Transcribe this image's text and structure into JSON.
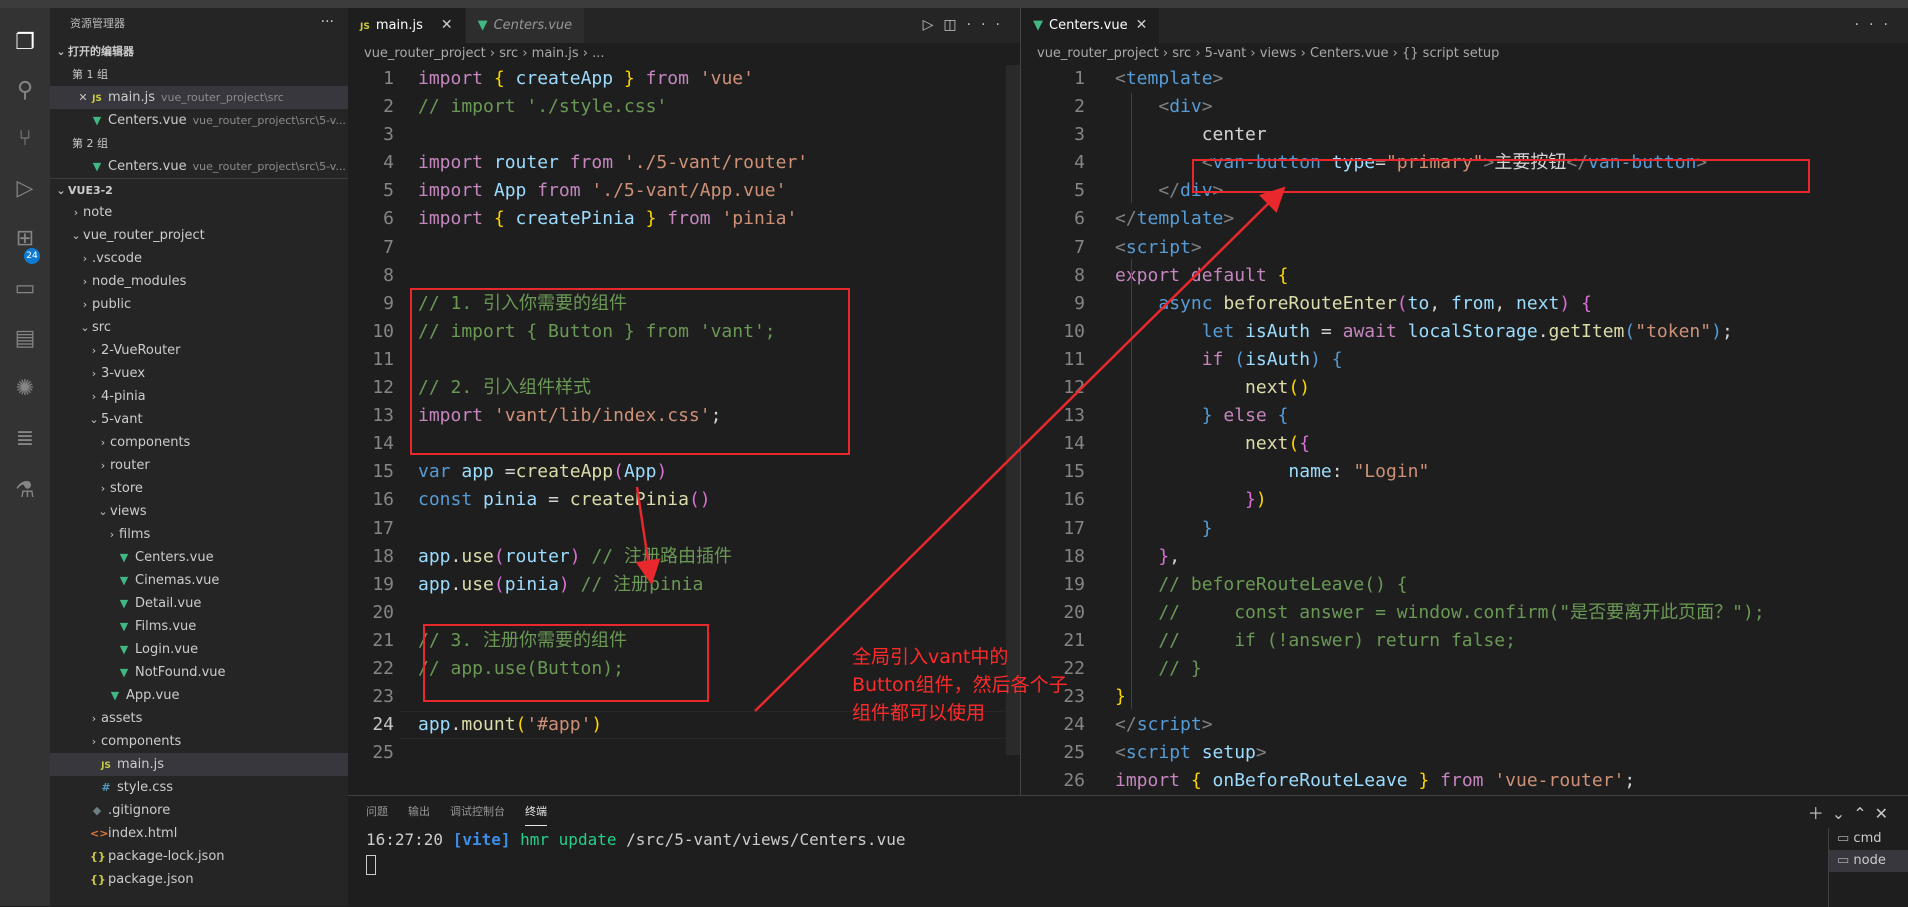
{
  "explorer": {
    "title": "资源管理器",
    "open_editors_header": "打开的编辑器",
    "group1": "第 1 组",
    "group1_file": "main.js",
    "group1_file_path": "vue_router_project\\src",
    "group1_file2": "Centers.vue",
    "group1_file2_path": "vue_router_project\\src\\5-v...",
    "group2": "第 2 组",
    "group2_file": "Centers.vue",
    "group2_file_path": "vue_router_project\\src\\5-v...",
    "workspace": "VUE3-2",
    "tree": [
      {
        "label": "note",
        "depth": 1,
        "kind": "folder",
        "open": false
      },
      {
        "label": "vue_router_project",
        "depth": 1,
        "kind": "folder",
        "open": true
      },
      {
        "label": ".vscode",
        "depth": 2,
        "kind": "folder",
        "open": false
      },
      {
        "label": "node_modules",
        "depth": 2,
        "kind": "folder",
        "open": false
      },
      {
        "label": "public",
        "depth": 2,
        "kind": "folder",
        "open": false
      },
      {
        "label": "src",
        "depth": 2,
        "kind": "folder",
        "open": true
      },
      {
        "label": "2-VueRouter",
        "depth": 3,
        "kind": "folder",
        "open": false
      },
      {
        "label": "3-vuex",
        "depth": 3,
        "kind": "folder",
        "open": false
      },
      {
        "label": "4-pinia",
        "depth": 3,
        "kind": "folder",
        "open": false
      },
      {
        "label": "5-vant",
        "depth": 3,
        "kind": "folder",
        "open": true
      },
      {
        "label": "components",
        "depth": 4,
        "kind": "folder",
        "open": false
      },
      {
        "label": "router",
        "depth": 4,
        "kind": "folder",
        "open": false
      },
      {
        "label": "store",
        "depth": 4,
        "kind": "folder",
        "open": false
      },
      {
        "label": "views",
        "depth": 4,
        "kind": "folder",
        "open": true
      },
      {
        "label": "films",
        "depth": 5,
        "kind": "folder",
        "open": false
      },
      {
        "label": "Centers.vue",
        "depth": 5,
        "kind": "vue"
      },
      {
        "label": "Cinemas.vue",
        "depth": 5,
        "kind": "vue"
      },
      {
        "label": "Detail.vue",
        "depth": 5,
        "kind": "vue"
      },
      {
        "label": "Films.vue",
        "depth": 5,
        "kind": "vue"
      },
      {
        "label": "Login.vue",
        "depth": 5,
        "kind": "vue"
      },
      {
        "label": "NotFound.vue",
        "depth": 5,
        "kind": "vue"
      },
      {
        "label": "App.vue",
        "depth": 4,
        "kind": "vue"
      },
      {
        "label": "assets",
        "depth": 3,
        "kind": "folder",
        "open": false
      },
      {
        "label": "components",
        "depth": 3,
        "kind": "folder",
        "open": false
      },
      {
        "label": "main.js",
        "depth": 3,
        "kind": "js",
        "selected": true
      },
      {
        "label": "style.css",
        "depth": 3,
        "kind": "css"
      },
      {
        "label": ".gitignore",
        "depth": 2,
        "kind": "git"
      },
      {
        "label": "index.html",
        "depth": 2,
        "kind": "html"
      },
      {
        "label": "package-lock.json",
        "depth": 2,
        "kind": "json"
      },
      {
        "label": "package.json",
        "depth": 2,
        "kind": "json"
      }
    ]
  },
  "activity_bar": {
    "icons": [
      "files-icon",
      "search-icon",
      "source-control-icon",
      "run-debug-icon",
      "extensions-icon",
      "remote-explorer-icon",
      "folder-icon",
      "openai-icon",
      "notes-icon",
      "testing-icon"
    ],
    "badge": "24"
  },
  "left_editor": {
    "tabs": [
      {
        "label": "main.js",
        "icon": "js",
        "active": true
      },
      {
        "label": "Centers.vue",
        "icon": "vue",
        "active": false
      }
    ],
    "breadcrumb": [
      "vue_router_project",
      "src",
      "main.js",
      "..."
    ],
    "current_line": 24,
    "lines": [
      [
        [
          "import ",
          "k"
        ],
        [
          "{ ",
          "y"
        ],
        [
          "createApp ",
          "v"
        ],
        [
          "} ",
          "y"
        ],
        [
          "from ",
          "k"
        ],
        [
          "'vue'",
          "s"
        ]
      ],
      [
        [
          "// import './style.css'",
          "c"
        ]
      ],
      [],
      [
        [
          "import ",
          "k"
        ],
        [
          "router ",
          "v"
        ],
        [
          "from ",
          "k"
        ],
        [
          "'./5-vant/router'",
          "s"
        ]
      ],
      [
        [
          "import ",
          "k"
        ],
        [
          "App ",
          "v"
        ],
        [
          "from ",
          "k"
        ],
        [
          "'./5-vant/App.vue'",
          "s"
        ]
      ],
      [
        [
          "import ",
          "k"
        ],
        [
          "{ ",
          "y"
        ],
        [
          "createPinia ",
          "v"
        ],
        [
          "} ",
          "y"
        ],
        [
          "from ",
          "k"
        ],
        [
          "'pinia'",
          "s"
        ]
      ],
      [],
      [],
      [
        [
          "// 1. 引入你需要的组件",
          "c"
        ]
      ],
      [
        [
          "// import { Button } from 'vant';",
          "c"
        ]
      ],
      [],
      [
        [
          "// 2. 引入组件样式",
          "c"
        ]
      ],
      [
        [
          "import ",
          "k"
        ],
        [
          "'vant/lib/index.css'",
          "s"
        ],
        [
          ";",
          "w"
        ]
      ],
      [],
      [
        [
          "var ",
          "kb"
        ],
        [
          "app ",
          "v"
        ],
        [
          "=",
          "w"
        ],
        [
          "createApp",
          "f"
        ],
        [
          "(",
          "p"
        ],
        [
          "App",
          "v"
        ],
        [
          ")",
          "p"
        ]
      ],
      [
        [
          "const ",
          "kb"
        ],
        [
          "pinia ",
          "v"
        ],
        [
          "= ",
          "w"
        ],
        [
          "createPinia",
          "f"
        ],
        [
          "()",
          "p"
        ]
      ],
      [],
      [
        [
          "app",
          "v"
        ],
        [
          ".",
          "w"
        ],
        [
          "use",
          "f"
        ],
        [
          "(",
          "p"
        ],
        [
          "router",
          "v"
        ],
        [
          ") ",
          "p"
        ],
        [
          "// 注册路由插件",
          "c"
        ]
      ],
      [
        [
          "app",
          "v"
        ],
        [
          ".",
          "w"
        ],
        [
          "use",
          "f"
        ],
        [
          "(",
          "p"
        ],
        [
          "pinia",
          "v"
        ],
        [
          ") ",
          "p"
        ],
        [
          "// 注册pinia",
          "c"
        ]
      ],
      [],
      [
        [
          "// 3. 注册你需要的组件",
          "c"
        ]
      ],
      [
        [
          "// app.use(Button);",
          "c"
        ]
      ],
      [],
      [
        [
          "app",
          "v"
        ],
        [
          ".",
          "w"
        ],
        [
          "mount",
          "f"
        ],
        [
          "(",
          "y"
        ],
        [
          "'#app'",
          "s"
        ],
        [
          ")",
          "y"
        ]
      ],
      []
    ]
  },
  "right_editor": {
    "tabs": [
      {
        "label": "Centers.vue",
        "icon": "vue",
        "active": true
      }
    ],
    "breadcrumb": [
      "vue_router_project",
      "src",
      "5-vant",
      "views",
      "Centers.vue",
      "{} script setup"
    ],
    "lines": [
      [
        [
          "<",
          "g"
        ],
        [
          "template",
          "kb"
        ],
        [
          ">",
          "g"
        ]
      ],
      [
        [
          "    <",
          "g"
        ],
        [
          "div",
          "kb"
        ],
        [
          ">",
          "g"
        ]
      ],
      [
        [
          "        center",
          "w"
        ]
      ],
      [
        [
          "        <",
          "g"
        ],
        [
          "van-button ",
          "kb"
        ],
        [
          "type",
          "v"
        ],
        [
          "=",
          "w"
        ],
        [
          "\"primary\"",
          "s"
        ],
        [
          ">",
          "g"
        ],
        [
          "主要按钮",
          "w"
        ],
        [
          "</",
          "g"
        ],
        [
          "van-button",
          "kb"
        ],
        [
          ">",
          "g"
        ]
      ],
      [
        [
          "    </",
          "g"
        ],
        [
          "div",
          "kb"
        ],
        [
          ">",
          "g"
        ]
      ],
      [
        [
          "</",
          "g"
        ],
        [
          "template",
          "kb"
        ],
        [
          ">",
          "g"
        ]
      ],
      [
        [
          "<",
          "g"
        ],
        [
          "script",
          "kb"
        ],
        [
          ">",
          "g"
        ]
      ],
      [
        [
          "export ",
          "k"
        ],
        [
          "default ",
          "k"
        ],
        [
          "{",
          "y"
        ]
      ],
      [
        [
          "    ",
          "w"
        ],
        [
          "async ",
          "kb"
        ],
        [
          "beforeRouteEnter",
          "f"
        ],
        [
          "(",
          "p"
        ],
        [
          "to",
          "v"
        ],
        [
          ", ",
          "w"
        ],
        [
          "from",
          "v"
        ],
        [
          ", ",
          "w"
        ],
        [
          "next",
          "v"
        ],
        [
          ") ",
          "p"
        ],
        [
          "{",
          "p"
        ]
      ],
      [
        [
          "        ",
          "w"
        ],
        [
          "let ",
          "kb"
        ],
        [
          "isAuth ",
          "v"
        ],
        [
          "= ",
          "w"
        ],
        [
          "await ",
          "k"
        ],
        [
          "localStorage",
          "v"
        ],
        [
          ".",
          "w"
        ],
        [
          "getItem",
          "f"
        ],
        [
          "(",
          "kb"
        ],
        [
          "\"token\"",
          "s"
        ],
        [
          ")",
          "kb"
        ],
        [
          ";",
          "w"
        ]
      ],
      [
        [
          "        ",
          "w"
        ],
        [
          "if ",
          "k"
        ],
        [
          "(",
          "kb"
        ],
        [
          "isAuth",
          "v"
        ],
        [
          ") ",
          "kb"
        ],
        [
          "{",
          "kb"
        ]
      ],
      [
        [
          "            ",
          "w"
        ],
        [
          "next",
          "f"
        ],
        [
          "()",
          "y"
        ]
      ],
      [
        [
          "        ",
          "w"
        ],
        [
          "} ",
          "kb"
        ],
        [
          "else ",
          "k"
        ],
        [
          "{",
          "kb"
        ]
      ],
      [
        [
          "            ",
          "w"
        ],
        [
          "next",
          "f"
        ],
        [
          "(",
          "y"
        ],
        [
          "{",
          "p"
        ]
      ],
      [
        [
          "                ",
          "w"
        ],
        [
          "name",
          "v"
        ],
        [
          ": ",
          "w"
        ],
        [
          "\"Login\"",
          "s"
        ]
      ],
      [
        [
          "            ",
          "w"
        ],
        [
          "}",
          "p"
        ],
        [
          ")",
          "y"
        ]
      ],
      [
        [
          "        ",
          "w"
        ],
        [
          "}",
          "kb"
        ]
      ],
      [
        [
          "    ",
          "w"
        ],
        [
          "}",
          "p"
        ],
        [
          ",",
          "w"
        ]
      ],
      [
        [
          "    // beforeRouteLeave() {",
          "c"
        ]
      ],
      [
        [
          "    //     const answer = window.confirm(\"是否要离开此页面？\");",
          "c"
        ]
      ],
      [
        [
          "    //     if (!answer) return false;",
          "c"
        ]
      ],
      [
        [
          "    // }",
          "c"
        ]
      ],
      [
        [
          "}",
          "y"
        ]
      ],
      [
        [
          "</",
          "g"
        ],
        [
          "script",
          "kb"
        ],
        [
          ">",
          "g"
        ]
      ],
      [
        [
          "<",
          "g"
        ],
        [
          "script ",
          "kb"
        ],
        [
          "setup",
          "v"
        ],
        [
          ">",
          "g"
        ]
      ],
      [
        [
          "import ",
          "k"
        ],
        [
          "{ ",
          "y"
        ],
        [
          "onBeforeRouteLeave ",
          "v"
        ],
        [
          "} ",
          "y"
        ],
        [
          "from ",
          "k"
        ],
        [
          "'vue-router'",
          "s"
        ],
        [
          ";",
          "w"
        ]
      ]
    ]
  },
  "panel": {
    "tabs": [
      {
        "label": "问题",
        "active": false
      },
      {
        "label": "输出",
        "active": false
      },
      {
        "label": "调试控制台",
        "active": false
      },
      {
        "label": "终端",
        "active": true
      }
    ],
    "terminal_time": "16:27:20",
    "terminal_tag": "[vite]",
    "terminal_msg": "hmr update",
    "terminal_path": "/src/5-vant/views/Centers.vue",
    "terminals": [
      {
        "label": "cmd",
        "selected": false
      },
      {
        "label": "node",
        "selected": true
      }
    ]
  },
  "annotation": {
    "note": "全局引入vant中的Button组件，然后各个子组件都可以使用",
    "color": "#e8282c"
  }
}
